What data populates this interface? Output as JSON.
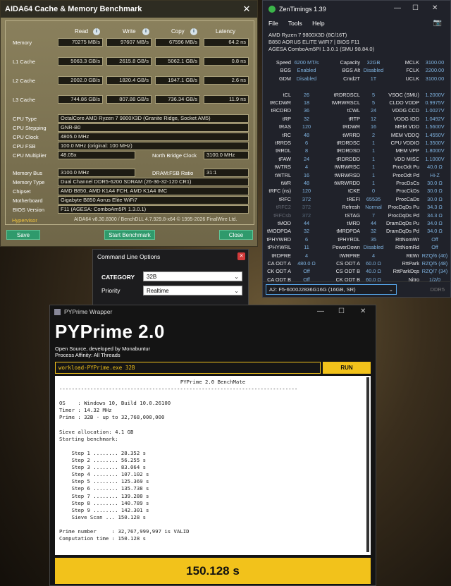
{
  "aida": {
    "title": "AIDA64 Cache & Memory Benchmark",
    "headers": [
      "Read",
      "Write",
      "Copy",
      "Latency"
    ],
    "rows": [
      {
        "label": "Memory",
        "read": "70275 MB/s",
        "write": "97607 MB/s",
        "copy": "67596 MB/s",
        "latency": "64.2 ns"
      },
      {
        "label": "L1 Cache",
        "read": "5063.3 GB/s",
        "write": "2615.8 GB/s",
        "copy": "5062.1 GB/s",
        "latency": "0.8 ns"
      },
      {
        "label": "L2 Cache",
        "read": "2002.0 GB/s",
        "write": "1820.4 GB/s",
        "copy": "1947.1 GB/s",
        "latency": "2.6 ns"
      },
      {
        "label": "L3 Cache",
        "read": "744.86 GB/s",
        "write": "807.88 GB/s",
        "copy": "736.34 GB/s",
        "latency": "11.9 ns"
      }
    ],
    "cpu_type_label": "CPU Type",
    "cpu_type": "OctalCore AMD Ryzen 7 9800X3D  (Granite Ridge, Socket AM5)",
    "cpu_stepping_label": "CPU Stepping",
    "cpu_stepping": "GNR-B0",
    "cpu_clock_label": "CPU Clock",
    "cpu_clock": "4805.0 MHz",
    "cpu_fsb_label": "CPU FSB",
    "cpu_fsb": "100.0 MHz  (original: 100 MHz)",
    "cpu_mult_label": "CPU Multiplier",
    "cpu_mult": "48.05x",
    "nb_clock_label": "North Bridge Clock",
    "nb_clock": "3100.0 MHz",
    "mem_bus_label": "Memory Bus",
    "mem_bus": "3100.0 MHz",
    "dram_ratio_label": "DRAM:FSB Ratio",
    "dram_ratio": "31:1",
    "mem_type_label": "Memory Type",
    "mem_type": "Dual Channel DDR5-6200 SDRAM  (26-36-32-120 CR1)",
    "chipset_label": "Chipset",
    "chipset": "AMD B850, AMD K1A4 FCH, AMD K1A4 IMC",
    "mobo_label": "Motherboard",
    "mobo": "Gigabyte B850 Aorus Elite WiFi7",
    "bios_label": "BIOS Version",
    "bios": "F11  (AGESA: ComboAm5PI 1.3.0.1)",
    "hypervisor": "Hypervisor",
    "footer": "AIDA64 v8.30.8300 / BenchDLL 4.7.929.8-x64  © 1995-2026 FinalWire Ltd.",
    "save": "Save",
    "start": "Start Benchmark",
    "close": "Close"
  },
  "zen": {
    "title": "ZenTimings 1.39",
    "menu": [
      "File",
      "Tools",
      "Help"
    ],
    "sys1": "AMD Ryzen 7 9800X3D (8C/16T)",
    "sys2": "B850 AORUS ELITE WIFI7 | BIOS F11",
    "sys3": "AGESA ComboAm5PI 1.3.0.1 (SMU 98.84.0)",
    "rows": [
      [
        "Speed",
        "6200 MT/s",
        "Capacity",
        "32GB",
        "MCLK",
        "3100.00"
      ],
      [
        "BGS",
        "Enabled",
        "BGS Alt",
        "Disabled",
        "FCLK",
        "2200.00"
      ],
      [
        "GDM",
        "Disabled",
        "Cmd2T",
        "1T",
        "UCLK",
        "3100.00"
      ],
      [
        "",
        "",
        "",
        "",
        "",
        ""
      ],
      [
        "tCL",
        "26",
        "tRDRDSCL",
        "5",
        "VSOC (SMU)",
        "1.2000V"
      ],
      [
        "tRCDWR",
        "18",
        "tWRWRSCL",
        "5",
        "CLDO VDDP",
        "0.9975V"
      ],
      [
        "tRCDRD",
        "36",
        "tCWL",
        "24",
        "VDDG CCD",
        "1.0027V"
      ],
      [
        "tRP",
        "32",
        "tRTP",
        "12",
        "VDDG IOD",
        "1.0492V"
      ],
      [
        "tRAS",
        "120",
        "tRDWR",
        "16",
        "MEM VDD",
        "1.5600V"
      ],
      [
        "tRC",
        "48",
        "tWRRD",
        "2",
        "MEM VDDQ",
        "1.4550V"
      ],
      [
        "tRRDS",
        "6",
        "tRDRDSC",
        "1",
        "CPU VDDIO",
        "1.3500V"
      ],
      [
        "tRRDL",
        "8",
        "tRDRDSD",
        "1",
        "MEM VPP",
        "1.8000V"
      ],
      [
        "tFAW",
        "24",
        "tRDRDDD",
        "1",
        "VDD MISC",
        "1.1000V"
      ],
      [
        "tWTRS",
        "4",
        "tWRWRSC",
        "1",
        "ProcOdt Pu",
        "40.0 Ω"
      ],
      [
        "tWTRL",
        "16",
        "tWRWRSD",
        "1",
        "ProcOdt Pd",
        "Hi-Z"
      ],
      [
        "tWR",
        "48",
        "tWRWRDD",
        "1",
        "ProcDsCs",
        "30.0 Ω"
      ],
      [
        "tRFC (ns)",
        "120",
        "tCKE",
        "0",
        "ProcCkDs",
        "30.0 Ω"
      ],
      [
        "tRFC",
        "372",
        "tREFI",
        "65535",
        "ProcCaDs",
        "30.0 Ω"
      ],
      [
        "tRFC2",
        "372",
        "Refresh",
        "Normal",
        "ProcDqDs Pu",
        "34.3 Ω"
      ],
      [
        "tRFCsb",
        "372",
        "tSTAG",
        "7",
        "ProcDqDs Pd",
        "34.3 Ω"
      ],
      [
        "tMOD",
        "44",
        "tMRD",
        "44",
        "DramDqDs Pu",
        "34.0 Ω"
      ],
      [
        "tMODPDA",
        "32",
        "tMRDPDA",
        "32",
        "DramDqDs Pd",
        "34.0 Ω"
      ],
      [
        "tPHYWRD",
        "6",
        "tPHYRDL",
        "35",
        "RttNomWr",
        "Off"
      ],
      [
        "tPHYWRL",
        "11",
        "PowerDown",
        "Disabled",
        "RttNomRd",
        "Off"
      ],
      [
        "tRDPRE",
        "4",
        "tWRPRE",
        "4",
        "RttWr",
        "RZQ/6 (40)"
      ],
      [
        "CA ODT A",
        "480.0 Ω",
        "CS ODT A",
        "60.0 Ω",
        "RttPark",
        "RZQ/5 (48)"
      ],
      [
        "CK ODT A",
        "Off",
        "CS ODT B",
        "40.0 Ω",
        "RttParkDqs",
        "RZQ/7 (34)"
      ],
      [
        "CA ODT B",
        "Off",
        "CK ODT B",
        "60.0 Ω",
        "Nitro",
        "1/2/0"
      ]
    ],
    "dimm": "A2:          F5-6000J2836G16G (16GB, SR)",
    "ddr": "DDR5"
  },
  "cmd": {
    "title": "Command Line Options",
    "category_label": "CATEGORY",
    "category_value": "32B",
    "priority_label": "Priority",
    "priority_value": "Realtime"
  },
  "pyp": {
    "window_title": "PYPrime Wrapper",
    "heading": "PYPrime 2.0",
    "sub1": "Open Source, developed by Monabuntur",
    "sub2": "Process Affinity: All Threads",
    "command": "workload-PYPrime.exe 32B",
    "run": "RUN",
    "console_title": "PYPrime 2.0 BenchMate",
    "console_body": "-----------------------------------------------------------------------------\n\nOS    : Windows 10, Build 10.0.26100\nTimer : 14.32 MHz\nPrime : 32B - up to 32,768,000,000\n\nSieve allocation: 4.1 GB\nStarting benchmark:\n\n    Step 1 ........ 28.352 s\n    Step 2 ........ 56.255 s\n    Step 3 ........ 83.064 s\n    Step 4 ........ 107.102 s\n    Step 5 ........ 125.369 s\n    Step 6 ........ 135.738 s\n    Step 7 ........ 139.280 s\n    Step 8 ........ 140.789 s\n    Step 9 ........ 142.301 s\n    Sieve Scan ... 150.128 s\n\nPrime number     : 32,767,999,997 is VALID\nComputation time : 150.128 s",
    "result": "150.128 s"
  }
}
